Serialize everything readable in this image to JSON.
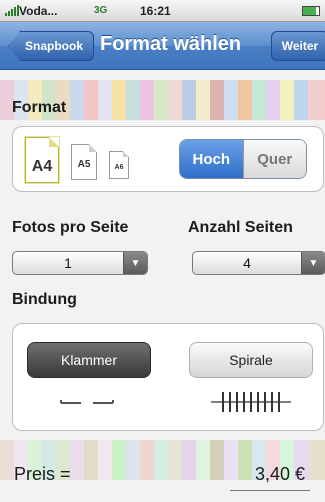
{
  "status_bar": {
    "carrier": "Voda...",
    "network": "3G",
    "time": "16:21"
  },
  "nav": {
    "back_label": "Snapbook",
    "title": "Format wählen",
    "next_label": "Weiter"
  },
  "format": {
    "label": "Format",
    "sizes": [
      "A4",
      "A5",
      "A6"
    ],
    "selected_size": "A4",
    "orientation": {
      "options": [
        "Hoch",
        "Quer"
      ],
      "selected": "Hoch"
    }
  },
  "photos_per_page": {
    "label": "Fotos pro Seite",
    "value": "1"
  },
  "page_count": {
    "label": "Anzahl Seiten",
    "value": "4"
  },
  "binding": {
    "label": "Bindung",
    "options": [
      "Klammer",
      "Spirale"
    ],
    "selected": "Klammer"
  },
  "price": {
    "label": "Preis =",
    "value": "3,40 €"
  },
  "colors": {
    "nav_blue": "#4a7fc5",
    "segment_active": "#2f6fc8",
    "binding_selected": "#3a3a3a"
  }
}
